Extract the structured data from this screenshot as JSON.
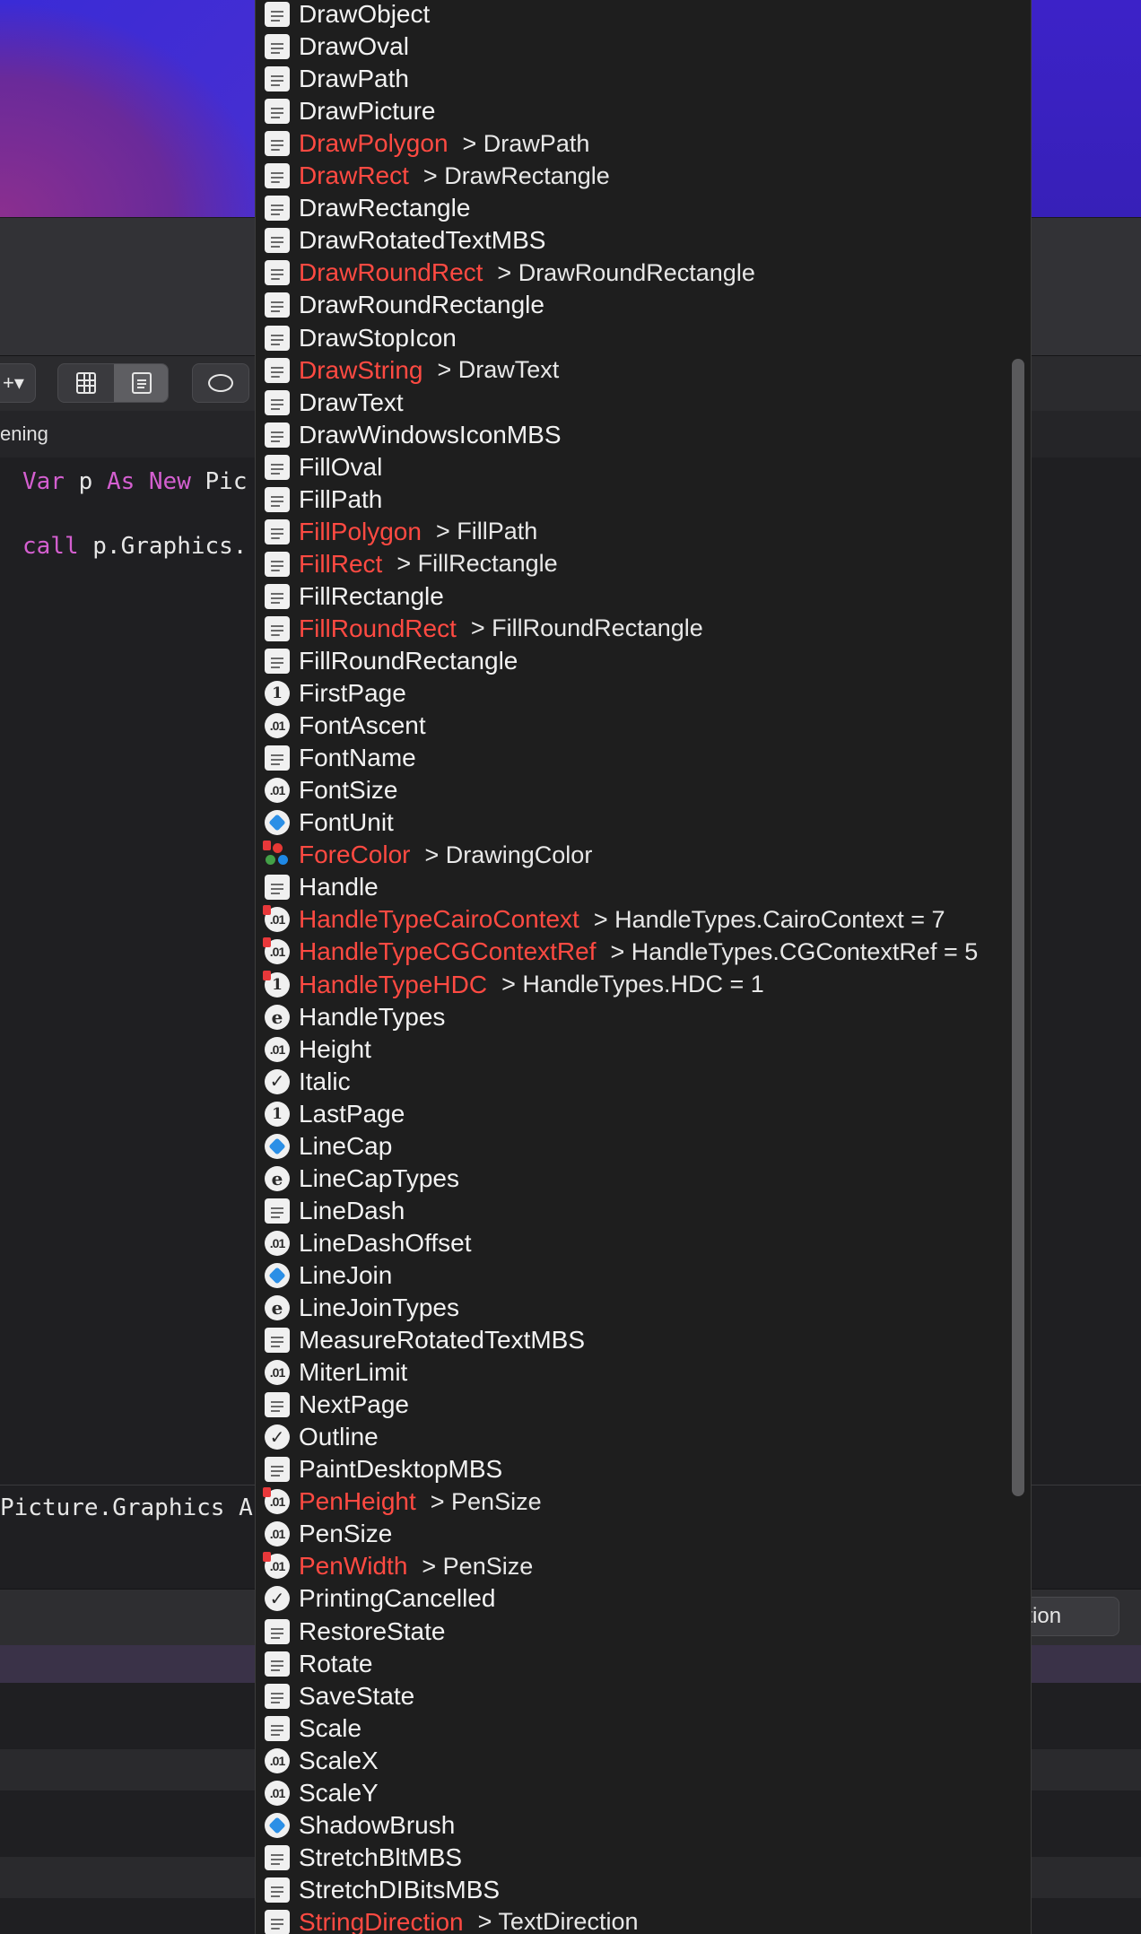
{
  "background": {
    "breadcrumb_fragment": "ening",
    "code_lines": [
      {
        "kw1": "Var",
        "t1": " p ",
        "kw2": "As",
        "t2": " ",
        "kw3": "New",
        "t3": " Pic"
      },
      {
        "kw1": "call",
        "t1": " p.Graphics.",
        "kw2": "",
        "t2": "",
        "kw3": "",
        "t3": ""
      }
    ],
    "bottom_code": "Picture.Graphics A",
    "toolbar_add_label": "+▾",
    "right_pill_text": "ation"
  },
  "autocomplete": {
    "items": [
      {
        "label": "DrawObject",
        "icon": "method-icon",
        "deprecated": false,
        "replacement": ""
      },
      {
        "label": "DrawOval",
        "icon": "method-icon",
        "deprecated": false,
        "replacement": ""
      },
      {
        "label": "DrawPath",
        "icon": "method-icon",
        "deprecated": false,
        "replacement": ""
      },
      {
        "label": "DrawPicture",
        "icon": "method-icon",
        "deprecated": false,
        "replacement": ""
      },
      {
        "label": "DrawPolygon",
        "icon": "method-icon",
        "deprecated": true,
        "replacement": "> DrawPath"
      },
      {
        "label": "DrawRect",
        "icon": "method-icon",
        "deprecated": true,
        "replacement": "> DrawRectangle"
      },
      {
        "label": "DrawRectangle",
        "icon": "method-icon",
        "deprecated": false,
        "replacement": ""
      },
      {
        "label": "DrawRotatedTextMBS",
        "icon": "method-icon",
        "deprecated": false,
        "replacement": ""
      },
      {
        "label": "DrawRoundRect",
        "icon": "method-icon",
        "deprecated": true,
        "replacement": "> DrawRoundRectangle"
      },
      {
        "label": "DrawRoundRectangle",
        "icon": "method-icon",
        "deprecated": false,
        "replacement": ""
      },
      {
        "label": "DrawStopIcon",
        "icon": "method-icon",
        "deprecated": false,
        "replacement": ""
      },
      {
        "label": "DrawString",
        "icon": "method-icon",
        "deprecated": true,
        "replacement": "> DrawText"
      },
      {
        "label": "DrawText",
        "icon": "method-icon",
        "deprecated": false,
        "replacement": ""
      },
      {
        "label": "DrawWindowsIconMBS",
        "icon": "method-icon",
        "deprecated": false,
        "replacement": ""
      },
      {
        "label": "FillOval",
        "icon": "method-icon",
        "deprecated": false,
        "replacement": ""
      },
      {
        "label": "FillPath",
        "icon": "method-icon",
        "deprecated": false,
        "replacement": ""
      },
      {
        "label": "FillPolygon",
        "icon": "method-icon",
        "deprecated": true,
        "replacement": "> FillPath"
      },
      {
        "label": "FillRect",
        "icon": "method-icon",
        "deprecated": true,
        "replacement": "> FillRectangle"
      },
      {
        "label": "FillRectangle",
        "icon": "method-icon",
        "deprecated": false,
        "replacement": ""
      },
      {
        "label": "FillRoundRect",
        "icon": "method-icon",
        "deprecated": true,
        "replacement": "> FillRoundRectangle"
      },
      {
        "label": "FillRoundRectangle",
        "icon": "method-icon",
        "deprecated": false,
        "replacement": ""
      },
      {
        "label": "FirstPage",
        "icon": "integer-icon",
        "deprecated": false,
        "replacement": ""
      },
      {
        "label": "FontAscent",
        "icon": "double-icon",
        "deprecated": false,
        "replacement": ""
      },
      {
        "label": "FontName",
        "icon": "method-icon",
        "deprecated": false,
        "replacement": ""
      },
      {
        "label": "FontSize",
        "icon": "double-icon",
        "deprecated": false,
        "replacement": ""
      },
      {
        "label": "FontUnit",
        "icon": "object-icon",
        "deprecated": false,
        "replacement": ""
      },
      {
        "label": "ForeColor",
        "icon": "color-icon",
        "deprecated": true,
        "replacement": "> DrawingColor"
      },
      {
        "label": "Handle",
        "icon": "method-icon",
        "deprecated": false,
        "replacement": ""
      },
      {
        "label": "HandleTypeCairoContext",
        "icon": "double-icon",
        "deprecated": true,
        "replacement": "> HandleTypes.CairoContext = 7"
      },
      {
        "label": "HandleTypeCGContextRef",
        "icon": "double-icon",
        "deprecated": true,
        "replacement": "> HandleTypes.CGContextRef = 5"
      },
      {
        "label": "HandleTypeHDC",
        "icon": "integer-icon",
        "deprecated": true,
        "replacement": "> HandleTypes.HDC = 1"
      },
      {
        "label": "HandleTypes",
        "icon": "enum-icon",
        "deprecated": false,
        "replacement": ""
      },
      {
        "label": "Height",
        "icon": "double-icon",
        "deprecated": false,
        "replacement": ""
      },
      {
        "label": "Italic",
        "icon": "boolean-icon",
        "deprecated": false,
        "replacement": ""
      },
      {
        "label": "LastPage",
        "icon": "integer-icon",
        "deprecated": false,
        "replacement": ""
      },
      {
        "label": "LineCap",
        "icon": "object-icon",
        "deprecated": false,
        "replacement": ""
      },
      {
        "label": "LineCapTypes",
        "icon": "enum-icon",
        "deprecated": false,
        "replacement": ""
      },
      {
        "label": "LineDash",
        "icon": "method-icon",
        "deprecated": false,
        "replacement": ""
      },
      {
        "label": "LineDashOffset",
        "icon": "double-icon",
        "deprecated": false,
        "replacement": ""
      },
      {
        "label": "LineJoin",
        "icon": "object-icon",
        "deprecated": false,
        "replacement": ""
      },
      {
        "label": "LineJoinTypes",
        "icon": "enum-icon",
        "deprecated": false,
        "replacement": ""
      },
      {
        "label": "MeasureRotatedTextMBS",
        "icon": "method-icon",
        "deprecated": false,
        "replacement": ""
      },
      {
        "label": "MiterLimit",
        "icon": "double-icon",
        "deprecated": false,
        "replacement": ""
      },
      {
        "label": "NextPage",
        "icon": "method-icon",
        "deprecated": false,
        "replacement": ""
      },
      {
        "label": "Outline",
        "icon": "boolean-icon",
        "deprecated": false,
        "replacement": ""
      },
      {
        "label": "PaintDesktopMBS",
        "icon": "method-icon",
        "deprecated": false,
        "replacement": ""
      },
      {
        "label": "PenHeight",
        "icon": "double-icon",
        "deprecated": true,
        "replacement": "> PenSize"
      },
      {
        "label": "PenSize",
        "icon": "double-icon",
        "deprecated": false,
        "replacement": ""
      },
      {
        "label": "PenWidth",
        "icon": "double-icon",
        "deprecated": true,
        "replacement": "> PenSize"
      },
      {
        "label": "PrintingCancelled",
        "icon": "boolean-icon",
        "deprecated": false,
        "replacement": ""
      },
      {
        "label": "RestoreState",
        "icon": "method-icon",
        "deprecated": false,
        "replacement": ""
      },
      {
        "label": "Rotate",
        "icon": "method-icon",
        "deprecated": false,
        "replacement": ""
      },
      {
        "label": "SaveState",
        "icon": "method-icon",
        "deprecated": false,
        "replacement": ""
      },
      {
        "label": "Scale",
        "icon": "method-icon",
        "deprecated": false,
        "replacement": ""
      },
      {
        "label": "ScaleX",
        "icon": "double-icon",
        "deprecated": false,
        "replacement": ""
      },
      {
        "label": "ScaleY",
        "icon": "double-icon",
        "deprecated": false,
        "replacement": ""
      },
      {
        "label": "ShadowBrush",
        "icon": "object-icon",
        "deprecated": false,
        "replacement": ""
      },
      {
        "label": "StretchBltMBS",
        "icon": "method-icon",
        "deprecated": false,
        "replacement": ""
      },
      {
        "label": "StretchDIBitsMBS",
        "icon": "method-icon",
        "deprecated": false,
        "replacement": ""
      },
      {
        "label": "StringDirection",
        "icon": "method-icon",
        "deprecated": true,
        "replacement": "> TextDirection"
      }
    ],
    "icon_glyphs": {
      "integer-icon": "1",
      "double-icon": ".01",
      "enum-icon": "e",
      "boolean-icon": "✓"
    },
    "colors": {
      "deprecated_label": "#ff4a42",
      "label": "#f2f2f2",
      "popup_bg": "#1e1e1e",
      "object_icon": "#2b8fe6"
    }
  }
}
